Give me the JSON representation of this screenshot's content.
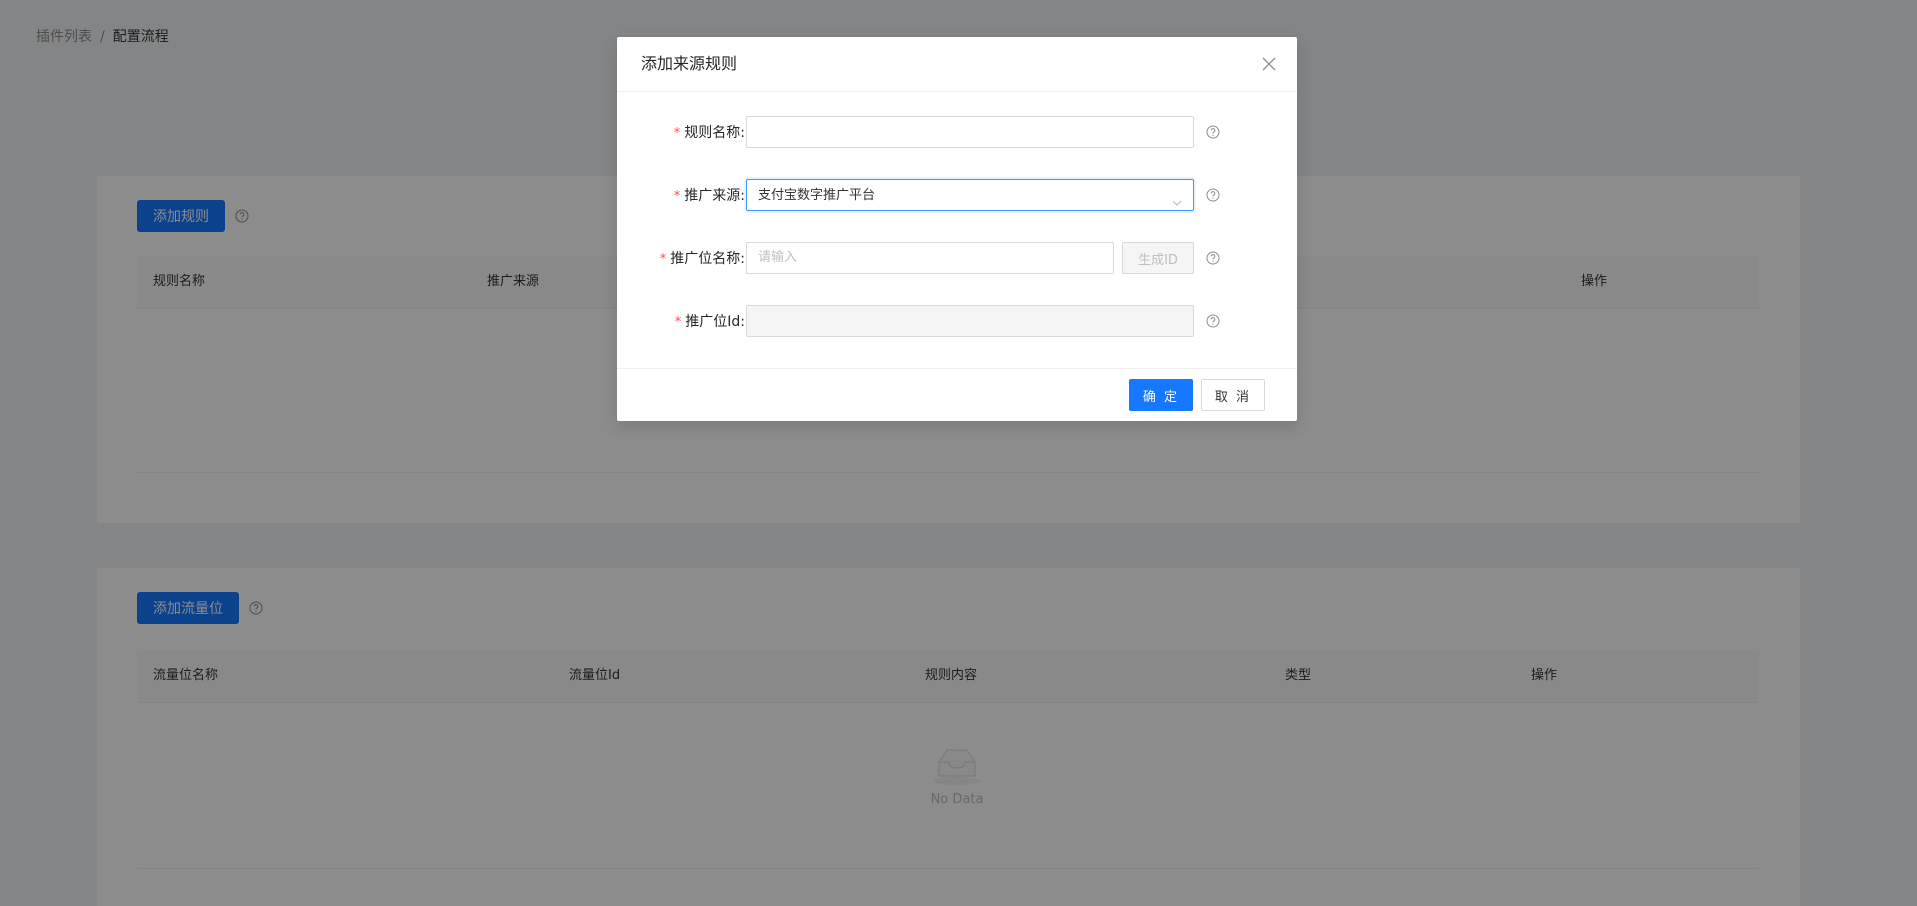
{
  "breadcrumb": {
    "parent": "插件列表",
    "separator": "/",
    "current": "配置流程"
  },
  "rules_section": {
    "add_button": "添加规则",
    "columns": [
      "规则名称",
      "推广来源",
      "操作"
    ]
  },
  "traffic_section": {
    "add_button": "添加流量位",
    "columns": [
      "流量位名称",
      "流量位Id",
      "规则内容",
      "类型",
      "操作"
    ],
    "empty_text": "No Data"
  },
  "modal": {
    "title": "添加来源规则",
    "fields": {
      "rule_name": {
        "label": "规则名称:",
        "value": ""
      },
      "source": {
        "label": "推广来源:",
        "value": "支付宝数字推广平台"
      },
      "position_name": {
        "label": "推广位名称:",
        "placeholder": "请输入",
        "generate_button": "生成ID"
      },
      "position_id": {
        "label": "推广位Id:",
        "value": ""
      }
    },
    "required_mark": "*",
    "ok_button": "确 定",
    "cancel_button": "取 消"
  },
  "colors": {
    "primary": "#1677ff",
    "required": "#ff4d4f",
    "mask": "rgba(0,0,0,0.45)"
  },
  "icons": [
    "question-circle-icon",
    "close-icon",
    "chevron-down-icon",
    "empty-inbox-icon"
  ]
}
